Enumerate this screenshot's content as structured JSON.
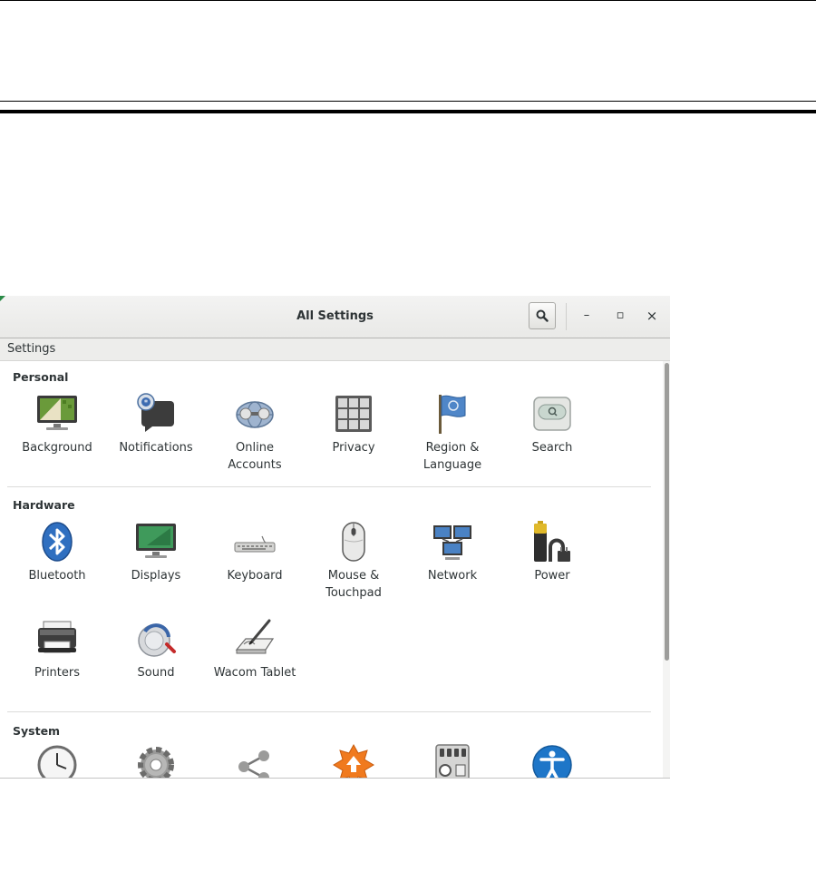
{
  "window": {
    "title": "All Settings",
    "subtitle": "Settings",
    "controls": {
      "minimize": "–",
      "maximize": "▫",
      "close": "×"
    }
  },
  "sections": [
    {
      "title": "Personal",
      "items": [
        {
          "label": "Background",
          "icon": "background-icon"
        },
        {
          "label": "Notifications",
          "icon": "notifications-icon"
        },
        {
          "label": "Online\nAccounts",
          "icon": "online-accounts-icon"
        },
        {
          "label": "Privacy",
          "icon": "privacy-icon"
        },
        {
          "label": "Region &\nLanguage",
          "icon": "region-language-icon"
        },
        {
          "label": "Search",
          "icon": "search-settings-icon"
        }
      ]
    },
    {
      "title": "Hardware",
      "items": [
        {
          "label": "Bluetooth",
          "icon": "bluetooth-icon"
        },
        {
          "label": "Displays",
          "icon": "displays-icon"
        },
        {
          "label": "Keyboard",
          "icon": "keyboard-icon"
        },
        {
          "label": "Mouse &\nTouchpad",
          "icon": "mouse-icon"
        },
        {
          "label": "Network",
          "icon": "network-icon"
        },
        {
          "label": "Power",
          "icon": "power-icon"
        },
        {
          "label": "Printers",
          "icon": "printer-icon"
        },
        {
          "label": "Sound",
          "icon": "sound-icon"
        },
        {
          "label": "Wacom Tablet",
          "icon": "wacom-tablet-icon"
        }
      ]
    },
    {
      "title": "System",
      "items": [
        {
          "label": "",
          "icon": "clock-icon"
        },
        {
          "label": "",
          "icon": "gear-icon"
        },
        {
          "label": "",
          "icon": "share-icon"
        },
        {
          "label": "",
          "icon": "update-icon"
        },
        {
          "label": "",
          "icon": "system-info-icon"
        },
        {
          "label": "",
          "icon": "accessibility-icon"
        }
      ]
    }
  ],
  "colors": {
    "titlebar": "#eeeeec",
    "subbar": "#ededeb",
    "text": "#2e3436",
    "accent_blue": "#2a6fbf",
    "accessibility_blue": "#1e76c8"
  }
}
